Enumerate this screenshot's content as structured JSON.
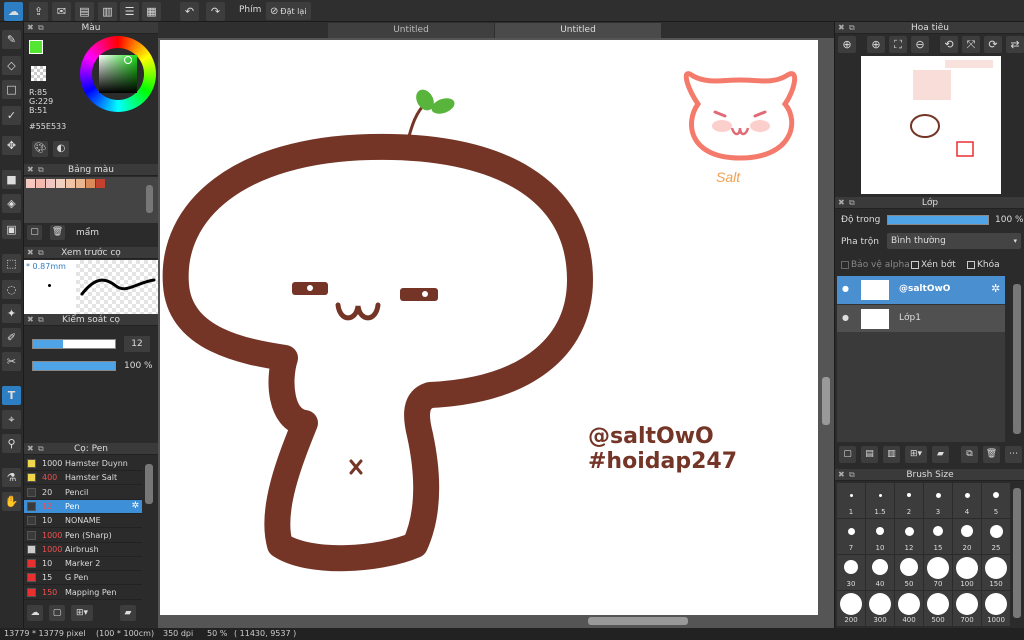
{
  "toolbar": {
    "shortcut_label": "Phím",
    "reset_label": "Đặt lại"
  },
  "tabs": [
    "Untitled",
    "Untitled"
  ],
  "color_panel": {
    "title": "Màu",
    "r": "R:85",
    "g": "G:229",
    "b": "B:51",
    "hex": "#55E533",
    "primary": "#55E533"
  },
  "palette_panel": {
    "title": "Bảng màu",
    "swatches": [
      "#f6c7bf",
      "#f3b9ae",
      "#f0c6c2",
      "#efd0c1",
      "#f2c4a6",
      "#e8b690",
      "#db8a5a",
      "#c4412f"
    ],
    "name": "mẩm"
  },
  "brush_preview": {
    "title": "Xem trước cọ",
    "size": "* 0.87mm"
  },
  "brush_control": {
    "title": "Kiểm soát cọ",
    "size_value": "12",
    "size_fraction": 0.36,
    "opacity_value": "100 %",
    "opacity_fraction": 1.0
  },
  "brush_list": {
    "title": "Cọ: Pen",
    "items": [
      {
        "size": "1000",
        "name": "Hamster Duynn",
        "color": "#f0d64a",
        "size_color": "#dddddd",
        "selected": false
      },
      {
        "size": "400",
        "name": "Hamster Salt",
        "color": "#f0d64a",
        "size_color": "#f05050",
        "selected": false
      },
      {
        "size": "20",
        "name": "Pencil",
        "color": "#3a3a3a",
        "size_color": "#dddddd",
        "selected": false
      },
      {
        "size": "12",
        "name": "Pen",
        "color": "#3a3a3a",
        "size_color": "#f05050",
        "selected": true
      },
      {
        "size": "10",
        "name": "NONAME",
        "color": "#3a3a3a",
        "size_color": "#dddddd",
        "selected": false
      },
      {
        "size": "1000",
        "name": "Pen (Sharp)",
        "color": "#3a3a3a",
        "size_color": "#f05050",
        "selected": false
      },
      {
        "size": "1000",
        "name": "Airbrush",
        "color": "#cccccc",
        "size_color": "#f05050",
        "selected": false
      },
      {
        "size": "10",
        "name": "Marker 2",
        "color": "#e83030",
        "size_color": "#dddddd",
        "selected": false
      },
      {
        "size": "15",
        "name": "G Pen",
        "color": "#e83030",
        "size_color": "#dddddd",
        "selected": false
      },
      {
        "size": "150",
        "name": "Mapping Pen",
        "color": "#e83030",
        "size_color": "#f05050",
        "selected": false
      }
    ]
  },
  "canvas": {
    "text_line1": "@saltOwO",
    "text_line2": "#hoidap247",
    "logo_text": "Salt"
  },
  "navigator": {
    "title": "Hoa tiêu"
  },
  "layers": {
    "title": "Lớp",
    "opacity_label": "Độ trong",
    "opacity_value": "100 %",
    "opacity_fraction": 1.0,
    "blend_label": "Pha trộn",
    "blend_value": "Bình thường",
    "protect_alpha": "Bảo vệ alpha",
    "clipping": "Xén bớt",
    "lock": "Khóa",
    "items": [
      {
        "name": "@saltOwO",
        "selected": true
      },
      {
        "name": "Lớp1",
        "selected": false
      }
    ]
  },
  "brush_size": {
    "title": "Brush Size",
    "sizes": [
      "1",
      "1.5",
      "2",
      "3",
      "4",
      "5",
      "7",
      "10",
      "12",
      "15",
      "20",
      "25",
      "30",
      "40",
      "50",
      "70",
      "100",
      "150",
      "200",
      "300",
      "400",
      "500",
      "700",
      "1000"
    ]
  },
  "status_bar": {
    "size": "13779 * 13779 pixel",
    "physical": "(100 * 100cm)",
    "dpi": "350 dpi",
    "zoom": "50 %",
    "coords": "( 11430, 9537 )"
  }
}
